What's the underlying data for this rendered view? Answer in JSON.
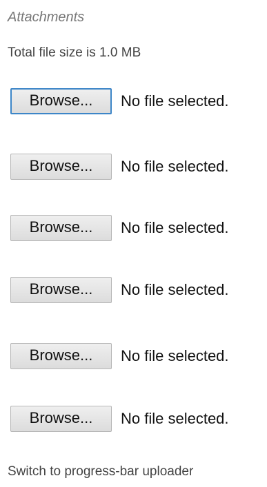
{
  "attachments": {
    "title": "Attachments",
    "total_size_text": "Total file size is 1.0 MB",
    "file_inputs": [
      {
        "button_label": "Browse...",
        "status": "No file selected.",
        "focused": true
      },
      {
        "button_label": "Browse...",
        "status": "No file selected.",
        "focused": false
      },
      {
        "button_label": "Browse...",
        "status": "No file selected.",
        "focused": false
      },
      {
        "button_label": "Browse...",
        "status": "No file selected.",
        "focused": false
      },
      {
        "button_label": "Browse...",
        "status": "No file selected.",
        "focused": false
      },
      {
        "button_label": "Browse...",
        "status": "No file selected.",
        "focused": false
      }
    ],
    "switch_link": "Switch to progress-bar uploader"
  },
  "colors": {
    "focus_border": "#3d86c8",
    "title_text": "#777777"
  }
}
